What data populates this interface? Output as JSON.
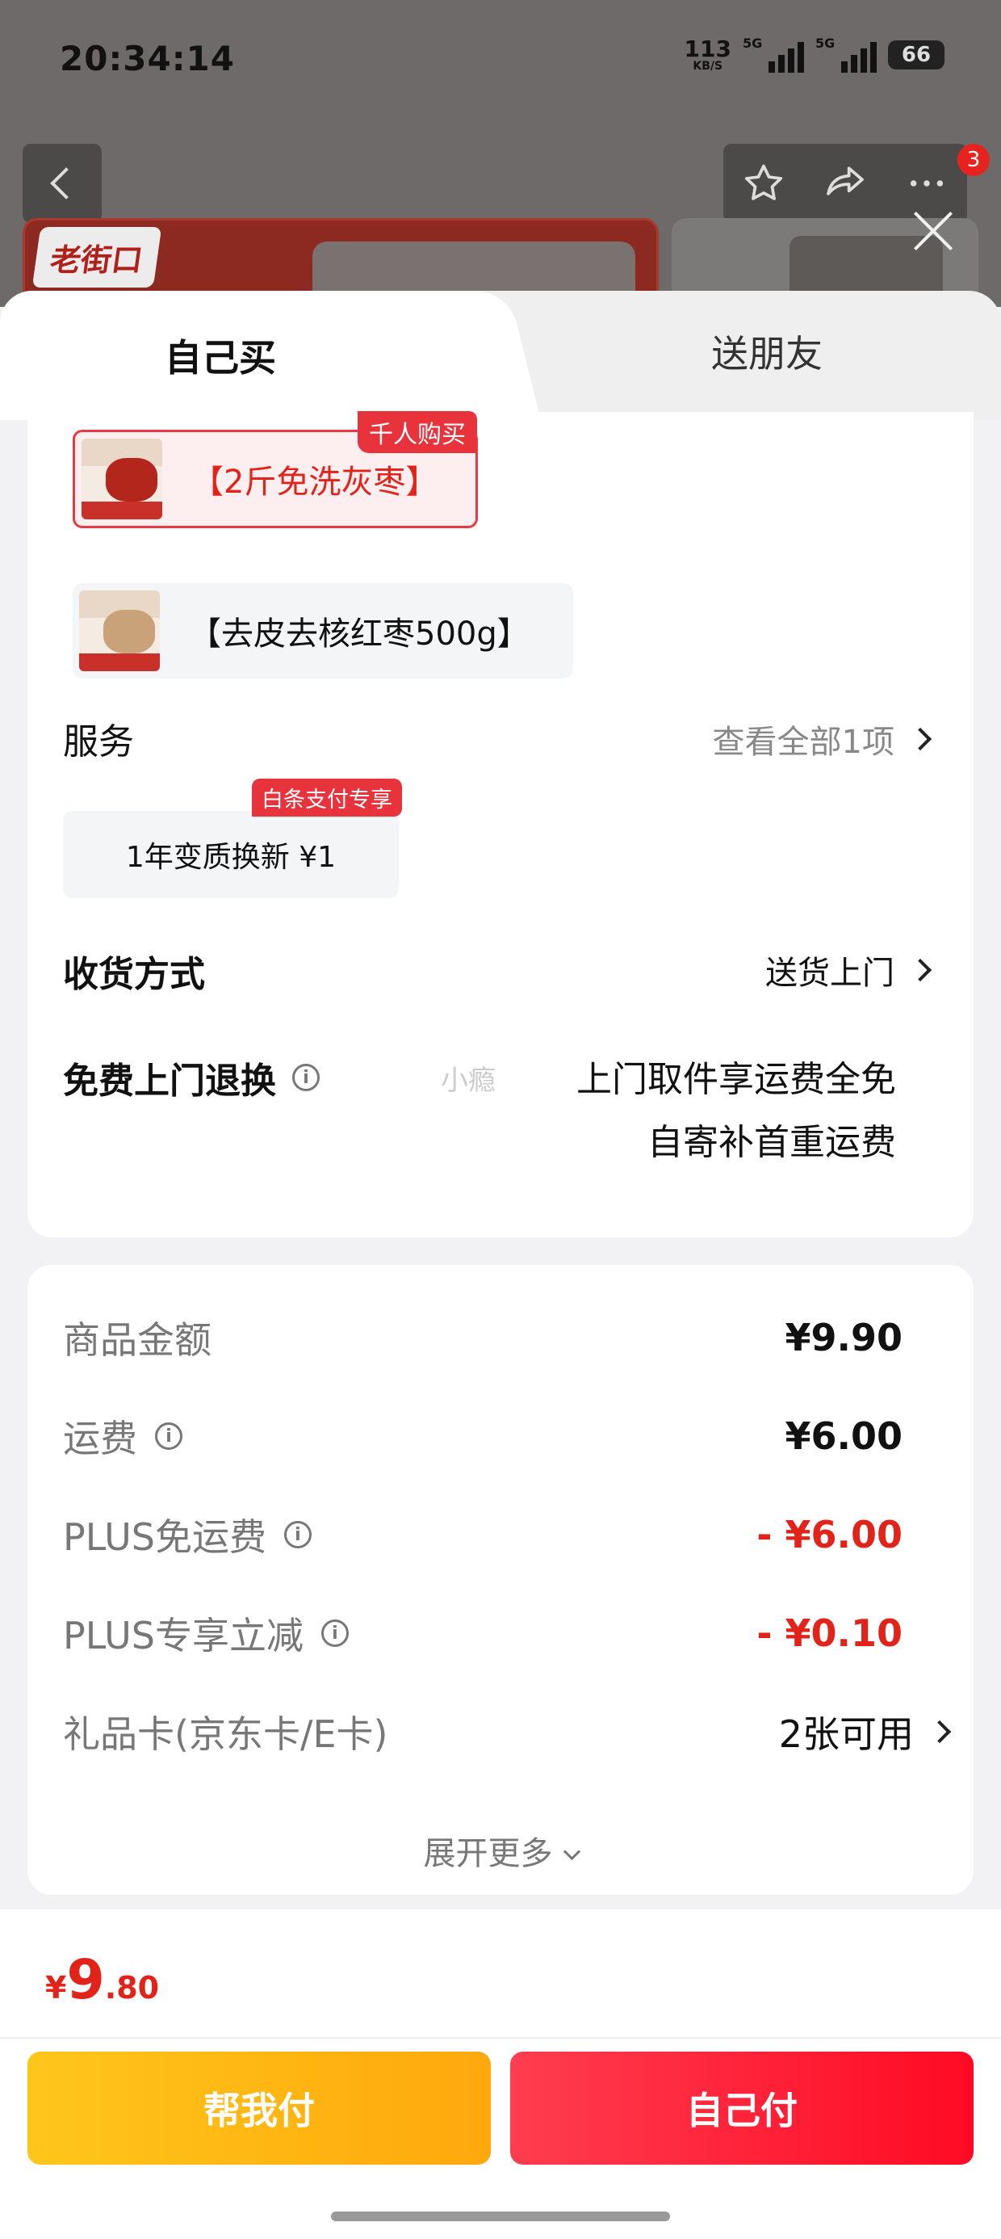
{
  "status_bar": {
    "time": "20:34:14",
    "net_speed": "113",
    "net_unit": "KB/S",
    "signal1_label": "5G",
    "signal2_label": "5G",
    "battery": "66"
  },
  "nav": {
    "cart_badge": "3"
  },
  "background_product": {
    "brand_logo": "老街口"
  },
  "tabs": {
    "self": "自己买",
    "friend": "送朋友"
  },
  "specs": [
    {
      "label": "【2斤免洗灰枣】",
      "tag": "千人购买",
      "selected": true
    },
    {
      "label": "【去皮去核红枣500g】",
      "selected": false
    }
  ],
  "service": {
    "title": "服务",
    "more": "查看全部1项",
    "item": "1年变质换新 ¥1",
    "item_tag": "白条支付专享"
  },
  "delivery": {
    "title": "收货方式",
    "value": "送货上门"
  },
  "returns": {
    "title": "免费上门退换",
    "watermark": "小瘾",
    "line1": "上门取件享运费全免",
    "line2": "自寄补首重运费"
  },
  "fees": {
    "goods_label": "商品金额",
    "goods_value": "¥9.90",
    "shipping_label": "运费",
    "shipping_value": "¥6.00",
    "plus_free_label": "PLUS免运费",
    "plus_free_value": "- ¥6.00",
    "plus_cut_label": "PLUS专享立减",
    "plus_cut_value": "- ¥0.10",
    "giftcard_label": "礼品卡(京东卡/E卡)",
    "giftcard_value": "2张可用",
    "expand": "展开更多"
  },
  "footer": {
    "currency": "¥",
    "total_int": "9",
    "total_dec": ".80",
    "help_pay": "帮我付",
    "self_pay": "自己付"
  },
  "colors": {
    "accent_red": "#e2231a",
    "help_btn": "#ffb512",
    "self_btn": "#ff1f38"
  }
}
